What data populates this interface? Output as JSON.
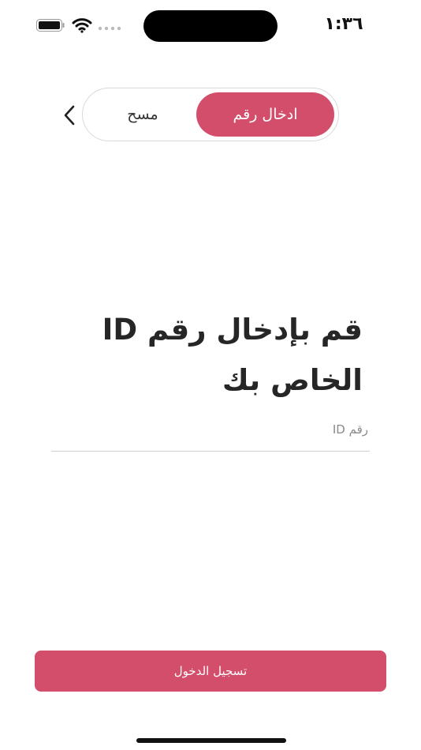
{
  "status_bar": {
    "time": "١:٣٦"
  },
  "header": {
    "back_icon": "chevron-left-icon",
    "tabs": [
      {
        "id": "scan",
        "label": "مسح",
        "selected": false
      },
      {
        "id": "enter_number",
        "label": "ادخال رقم",
        "selected": true
      }
    ]
  },
  "main": {
    "title": "قم بإدخال رقم ID الخاص بك",
    "id_input": {
      "value": "",
      "placeholder": "رقم ID"
    }
  },
  "footer": {
    "login_label": "تسجيل الدخول"
  },
  "colors": {
    "accent": "#d24e6b"
  }
}
